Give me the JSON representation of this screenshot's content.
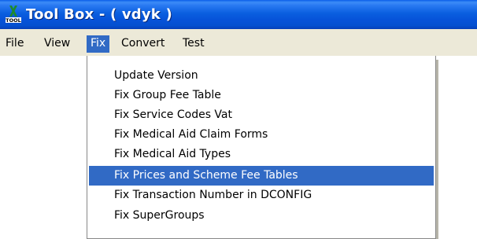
{
  "window": {
    "title": "Tool Box - ( vdyk )",
    "icon": "tool-app-icon",
    "icon_label": "TOOL"
  },
  "menubar": {
    "items": [
      {
        "label": "File"
      },
      {
        "label": "View"
      },
      {
        "label": "Fix",
        "active": true
      },
      {
        "label": "Convert"
      },
      {
        "label": "Test"
      }
    ]
  },
  "fix_menu": {
    "items": [
      {
        "label": "Update Version"
      },
      {
        "label": "Fix Group Fee Table"
      },
      {
        "label": "Fix Service Codes Vat"
      },
      {
        "label": "Fix Medical Aid Claim Forms"
      },
      {
        "label": "Fix Medical Aid Types"
      },
      {
        "label": "Fix Prices and Scheme Fee Tables",
        "highlighted": true
      },
      {
        "label": "Fix Transaction Number in DCONFIG"
      },
      {
        "label": "Fix SuperGroups"
      }
    ]
  },
  "colors": {
    "title_bar": "#0a5fe0",
    "menu_bar": "#ece9d8",
    "highlight": "#316ac5",
    "icon_green": "#1e8a2e"
  }
}
